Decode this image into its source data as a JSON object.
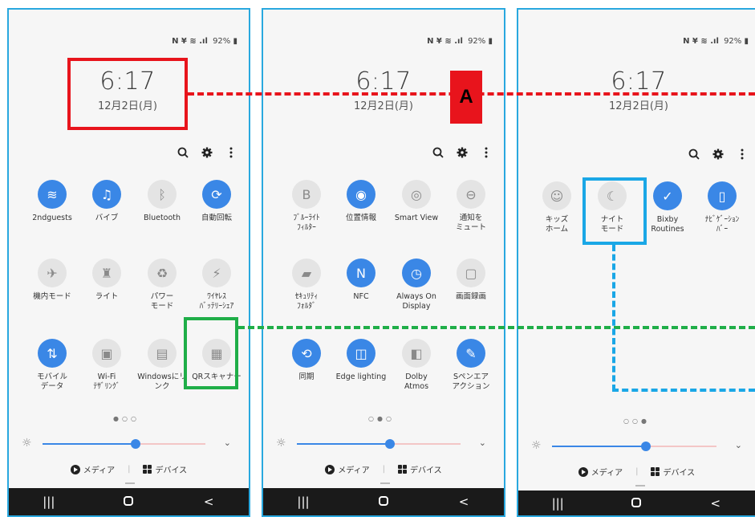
{
  "status": {
    "icons": "N ¥ ≋ .ıl",
    "battery": "92%"
  },
  "clock": {
    "time": "6:17",
    "date": "12月2日(月)"
  },
  "pages": [
    {
      "tiles": [
        {
          "label": "2ndguests",
          "icon": "wifi-icon",
          "on": true
        },
        {
          "label": "バイブ",
          "icon": "vibrate-icon",
          "on": true
        },
        {
          "label": "Bluetooth",
          "icon": "bluetooth-icon",
          "on": false
        },
        {
          "label": "自動回転",
          "icon": "auto-rotate-icon",
          "on": true
        },
        {
          "label": "機内モード",
          "icon": "airplane-icon",
          "on": false
        },
        {
          "label": "ライト",
          "icon": "flashlight-icon",
          "on": false
        },
        {
          "label": "パワー\nモード",
          "icon": "power-mode-icon",
          "on": false
        },
        {
          "label": "ﾜｲﾔﾚｽ\nﾊﾞｯﾃﾘｰｼｪｱ",
          "icon": "wireless-share-icon",
          "on": false
        },
        {
          "label": "モバイル\nデータ",
          "icon": "mobile-data-icon",
          "on": true
        },
        {
          "label": "Wi-Fi\nﾃｻﾞﾘﾝｸﾞ",
          "icon": "tethering-icon",
          "on": false
        },
        {
          "label": "Windowsにリ\nンク",
          "icon": "link-windows-icon",
          "on": false
        },
        {
          "label": "QRスキャナー",
          "icon": "qr-scanner-icon",
          "on": false
        }
      ]
    },
    {
      "tiles": [
        {
          "label": "ﾌﾞﾙｰﾗｲﾄ\nﾌｨﾙﾀｰ",
          "icon": "blue-light-icon",
          "on": false
        },
        {
          "label": "位置情報",
          "icon": "location-icon",
          "on": true
        },
        {
          "label": "Smart View",
          "icon": "smart-view-icon",
          "on": false
        },
        {
          "label": "通知を\nミュート",
          "icon": "mute-icon",
          "on": false
        },
        {
          "label": "ｾｷｭﾘﾃｨ\nﾌｫﾙﾀﾞ",
          "icon": "secure-folder-icon",
          "on": false
        },
        {
          "label": "NFC",
          "icon": "nfc-icon",
          "on": true
        },
        {
          "label": "Always On\nDisplay",
          "icon": "aod-icon",
          "on": true
        },
        {
          "label": "画面録画",
          "icon": "screen-record-icon",
          "on": false
        },
        {
          "label": "同期",
          "icon": "sync-icon",
          "on": true
        },
        {
          "label": "Edge lighting",
          "icon": "edge-lighting-icon",
          "on": true
        },
        {
          "label": "Dolby\nAtmos",
          "icon": "dolby-icon",
          "on": false
        },
        {
          "label": "Sペンエア\nアクション",
          "icon": "spen-icon",
          "on": true
        }
      ]
    },
    {
      "tiles": [
        {
          "label": "キッズ\nホーム",
          "icon": "kids-home-icon",
          "on": false
        },
        {
          "label": "ナイト\nモード",
          "icon": "night-mode-icon",
          "on": false
        },
        {
          "label": "Bixby\nRoutines",
          "icon": "bixby-icon",
          "on": true
        },
        {
          "label": "ﾅﾋﾞｹﾞｰｼｮﾝ\nﾊﾞｰ",
          "icon": "nav-bar-icon",
          "on": true
        }
      ]
    }
  ],
  "page_dots": [
    "●○○",
    "○●○",
    "○○●"
  ],
  "media": {
    "media_label": "メディア",
    "devices_label": "デバイス"
  },
  "brightness": {
    "level": 0.57
  },
  "annotation": {
    "tag": "A"
  },
  "nav": {
    "recents": "|||",
    "back": "<"
  }
}
